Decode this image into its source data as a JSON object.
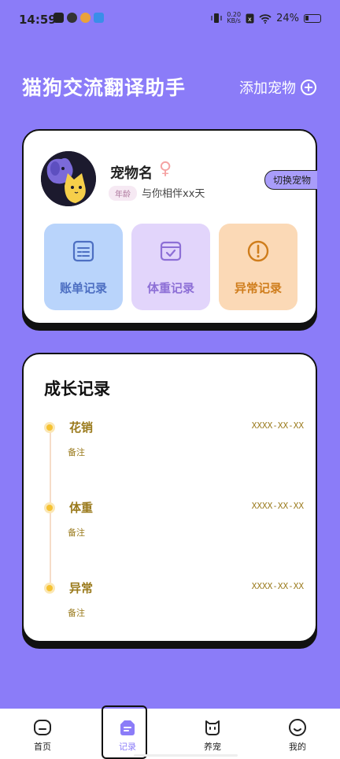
{
  "status": {
    "time": "14:59",
    "net_speed_top": "0.20",
    "net_speed_bottom": "KB/s",
    "battery": "24%"
  },
  "header": {
    "title": "猫狗交流翻译助手",
    "add_pet": "添加宠物"
  },
  "pet": {
    "name": "宠物名",
    "age_badge": "年龄",
    "with_you": "与你相伴xx天",
    "switch_pet": "切换宠物"
  },
  "tiles": [
    {
      "label": "账单记录",
      "icon": "bill-icon"
    },
    {
      "label": "体重记录",
      "icon": "weight-check-icon"
    },
    {
      "label": "异常记录",
      "icon": "exclamation-icon"
    }
  ],
  "growth": {
    "title": "成长记录",
    "items": [
      {
        "name": "花销",
        "date": "XXXX-XX-XX",
        "note": "备注"
      },
      {
        "name": "体重",
        "date": "XXXX-XX-XX",
        "note": "备注"
      },
      {
        "name": "异常",
        "date": "XXXX-XX-XX",
        "note": "备注"
      }
    ]
  },
  "tabs": [
    {
      "label": "首页",
      "icon": "home-icon"
    },
    {
      "label": "记录",
      "icon": "record-icon"
    },
    {
      "label": "养宠",
      "icon": "pet-icon"
    },
    {
      "label": "我的",
      "icon": "profile-icon"
    }
  ],
  "colors": {
    "background": "#8b7cf8",
    "accent": "#8b7cf8",
    "timeline": "#9a7a1c"
  }
}
